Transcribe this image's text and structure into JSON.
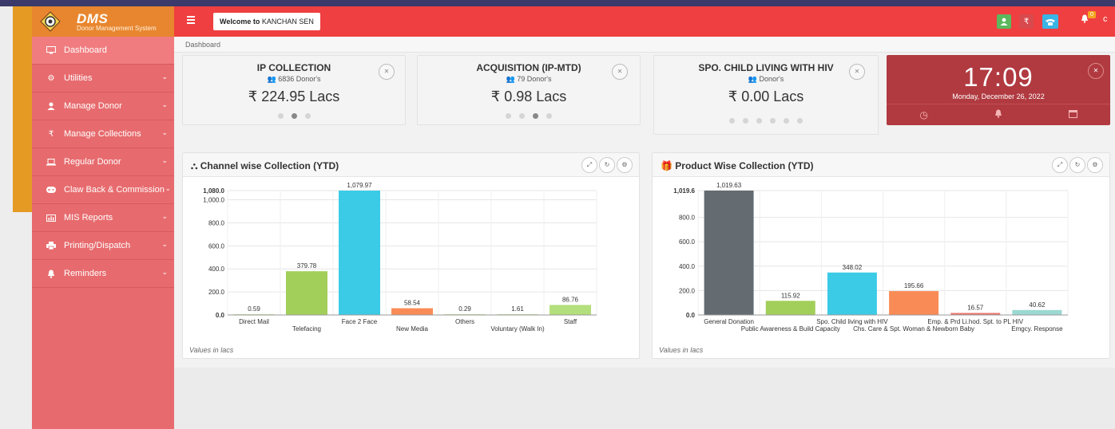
{
  "brand": {
    "title": "DMS",
    "subtitle": "Donor Management System"
  },
  "header": {
    "welcome_prefix": "Welcome to",
    "user": "KANCHAN SEN",
    "notif_count": "0",
    "edge_text": "c"
  },
  "breadcrumb": "Dashboard",
  "sidebar": {
    "items": [
      {
        "label": "Dashboard",
        "icon": "monitor-icon",
        "caret": false
      },
      {
        "label": "Utilities",
        "icon": "gears-icon",
        "caret": true
      },
      {
        "label": "Manage Donor",
        "icon": "user-icon",
        "caret": true
      },
      {
        "label": "Manage Collections",
        "icon": "rupee-icon",
        "caret": true
      },
      {
        "label": "Regular Donor",
        "icon": "laptop-icon",
        "caret": true
      },
      {
        "label": "Claw Back & Commission",
        "icon": "gamepad-icon",
        "caret": true
      },
      {
        "label": "MIS Reports",
        "icon": "bar-chart-icon",
        "caret": true
      },
      {
        "label": "Printing/Dispatch",
        "icon": "print-icon",
        "caret": true
      },
      {
        "label": "Reminders",
        "icon": "bell-icon",
        "caret": true
      }
    ]
  },
  "kpis": [
    {
      "title": "IP COLLECTION",
      "donors": "6836 Donor's",
      "amount": "₹ 224.95 Lacs",
      "dots": 3,
      "active_dot": 1
    },
    {
      "title": "ACQUISITION (IP-MTD)",
      "donors": "79 Donor's",
      "amount": "₹ 0.98 Lacs",
      "dots": 4,
      "active_dot": 2
    },
    {
      "title": "SPO. CHILD LIVING WITH HIV",
      "donors": "Donor's",
      "amount": "₹ 0.00 Lacs",
      "dots": 6,
      "active_dot": -1
    }
  ],
  "clock": {
    "time": "17:09",
    "date": "Monday, December 26, 2022"
  },
  "panels": [
    {
      "title": "Channel wise Collection (YTD)",
      "footer": "Values in lacs"
    },
    {
      "title": "Product Wise Collection (YTD)",
      "footer": "Values in lacs"
    }
  ],
  "chart_data": [
    {
      "type": "bar",
      "title": "Channel wise Collection (YTD)",
      "categories": [
        "Direct Mail",
        "Telefacing",
        "Face 2 Face",
        "New Media",
        "Others",
        "Voluntary (Walk In)",
        "Staff"
      ],
      "values": [
        0.59,
        379.78,
        1079.97,
        58.54,
        0.29,
        1.61,
        86.76
      ],
      "value_labels": [
        "0.59",
        "379.78",
        "1,079.97",
        "58.54",
        "0.29",
        "1.61",
        "86.76"
      ],
      "colors": [
        "#a2cf5a",
        "#a2cf5a",
        "#3ccbe6",
        "#f98c56",
        "#a2cf5a",
        "#a2cf5a",
        "#b4df7d"
      ],
      "yticks": [
        "0.0",
        "200.0",
        "400.0",
        "600.0",
        "800.0",
        "1,000.0",
        "1,080.0"
      ],
      "ytick_values": [
        0,
        200,
        400,
        600,
        800,
        1000,
        1080
      ],
      "ylim": [
        0,
        1080
      ],
      "note": "Values in lacs"
    },
    {
      "type": "bar",
      "title": "Product Wise Collection (YTD)",
      "categories": [
        "General Donation",
        "Public Awareness & Build Capacity",
        "Spo. Child living with HIV",
        "Chs. Care & Spt. Woman & Newborn Baby",
        "Emp. & Prd Li.hod. Spt. to PL HIV",
        "Emgcy. Response"
      ],
      "values": [
        1019.63,
        115.92,
        348.02,
        195.66,
        16.57,
        40.62
      ],
      "value_labels": [
        "1,019.63",
        "115.92",
        "348.02",
        "195.66",
        "16.57",
        "40.62"
      ],
      "colors": [
        "#646c72",
        "#a2cf5a",
        "#3ccbe6",
        "#f98c56",
        "#e8786d",
        "#9bd8d2"
      ],
      "yticks": [
        "0.0",
        "200.0",
        "400.0",
        "600.0",
        "800.0",
        "1,019.6"
      ],
      "ytick_values": [
        0,
        200,
        400,
        600,
        800,
        1019.6
      ],
      "ylim": [
        0,
        1019.6
      ],
      "note": "Values in lacs"
    }
  ]
}
